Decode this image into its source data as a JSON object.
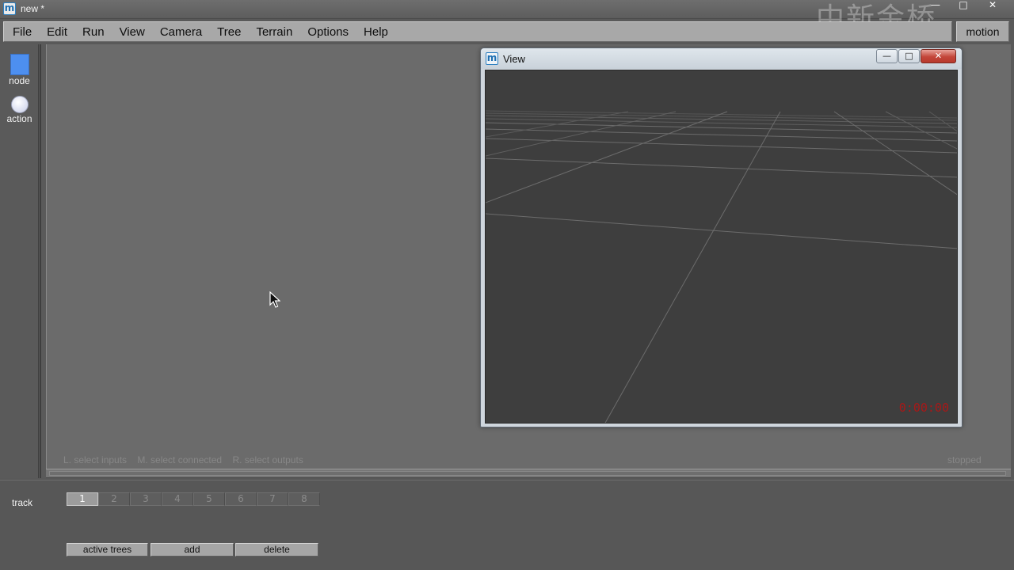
{
  "window": {
    "title": "new *",
    "app_icon": "m"
  },
  "watermark": "中新金桥",
  "menu": {
    "items": [
      "File",
      "Edit",
      "Run",
      "View",
      "Camera",
      "Tree",
      "Terrain",
      "Options",
      "Help"
    ],
    "mode_button": "motion"
  },
  "palette": {
    "node_label": "node",
    "action_label": "action",
    "node_color": "#4d8ff0"
  },
  "graph": {
    "hint": "L. select inputs    M. select connected    R. select outputs",
    "status": "stopped"
  },
  "view_window": {
    "title": "View",
    "timecode": "0:00:00",
    "timecode_color": "#a81818"
  },
  "track": {
    "label": "track",
    "tabs": [
      "1",
      "2",
      "3",
      "4",
      "5",
      "6",
      "7",
      "8"
    ],
    "active_tab": "1",
    "buttons": {
      "active_trees": "active trees",
      "add": "add",
      "delete": "delete"
    }
  }
}
